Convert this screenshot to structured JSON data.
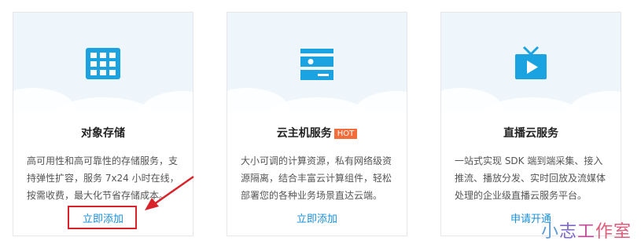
{
  "cards": [
    {
      "title": "对象存储",
      "icon": "grid-icon",
      "description": "高可用性和高可靠性的存储服务，支持弹性扩容，服务 7x24 小时在线，按需收费，最大化节省存储成本。",
      "action": "立即添加"
    },
    {
      "title": "云主机服务",
      "badge": "HOT",
      "icon": "server-icon",
      "description": "大小可调的计算资源，私有网络级资源隔离，结合丰富云计算组件，轻松部署您的各种业务场景直达云端。",
      "action": "立即添加"
    },
    {
      "title": "直播云服务",
      "icon": "tv-play-icon",
      "description": "一站式实现 SDK 端到端采集、接入推流、播放分发、实时回放及流媒体处理的企业级直播云服务平台。",
      "action": "申请开通"
    }
  ],
  "watermark": {
    "char1": "小",
    "char2": "志",
    "char3": "工",
    "char4": "作室"
  },
  "colors": {
    "accent": "#1a8fd8",
    "icon": "#1aa3e0",
    "hot": "#f36d3a",
    "highlight": "#d9232a",
    "card_top": "#eef6fc"
  }
}
